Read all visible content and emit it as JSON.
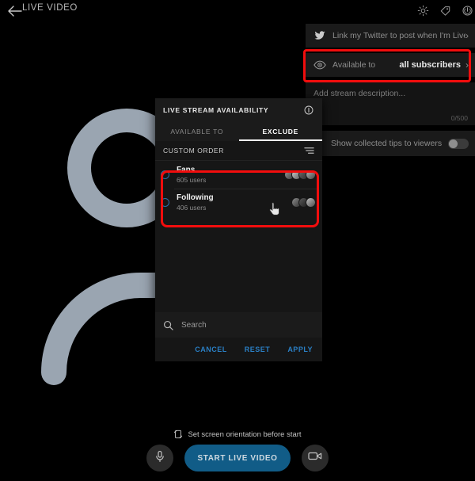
{
  "topbar": {
    "back_icon": "back-arrow-icon",
    "title": "LIVE VIDEO",
    "icons": [
      {
        "name": "settings-gear-icon",
        "label": "Settings"
      },
      {
        "name": "tag-icon",
        "label": "Tags"
      },
      {
        "name": "power-icon",
        "label": "Power"
      }
    ]
  },
  "settings_panel": {
    "twitter_row": {
      "icon": "twitter-bird-icon",
      "label": "Link my Twitter to post when I'm Live",
      "chevron": "›"
    },
    "available_row": {
      "icon": "eye-icon",
      "label": "Available to",
      "value": "all subscribers",
      "chevron": "›",
      "highlight_color": "#f20d0d"
    },
    "description": {
      "placeholder": "Add stream description...",
      "counter": "0/500"
    },
    "tips_row": {
      "label": "Show collected tips to viewers",
      "toggle_state": "off"
    }
  },
  "dialog": {
    "title": "LIVE STREAM AVAILABILITY",
    "info_icon": "info-circle-icon",
    "tabs": [
      {
        "label": "AVAILABLE TO",
        "active": false
      },
      {
        "label": "EXCLUDE",
        "active": true
      }
    ],
    "custom_order": {
      "label": "CUSTOM ORDER",
      "sort_icon": "sort-lines-icon"
    },
    "groups": [
      {
        "name": "Fans",
        "count": "605 users",
        "selected": false
      },
      {
        "name": "Following",
        "count": "406 users",
        "selected": false
      }
    ],
    "groups_highlight_color": "#f20d0d",
    "search": {
      "icon": "search-icon",
      "placeholder": "Search",
      "value": ""
    },
    "actions": [
      {
        "name": "cancel",
        "label": "CANCEL"
      },
      {
        "name": "reset",
        "label": "RESET"
      },
      {
        "name": "apply",
        "label": "APPLY"
      }
    ],
    "action_color": "#2a7fc4"
  },
  "bottom": {
    "orientation_icon": "screen-rotation-icon",
    "orientation_hint": "Set screen orientation before start",
    "mic_icon": "microphone-icon",
    "start_button": "START LIVE VIDEO",
    "start_button_color": "#115c87",
    "camera_icon": "video-camera-icon"
  }
}
